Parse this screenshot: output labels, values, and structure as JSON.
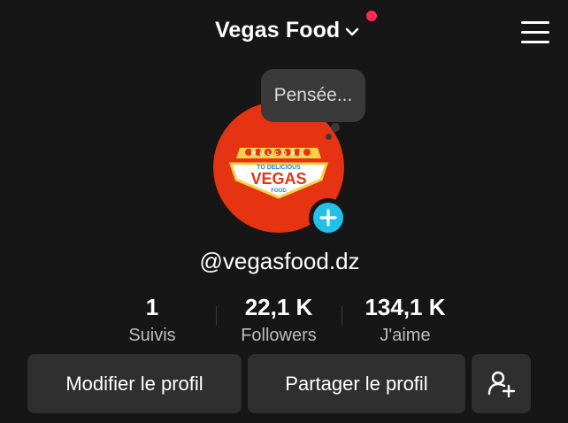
{
  "header": {
    "account_name": "Vegas Food",
    "notification_color": "#fe2c55",
    "menu_icon": "hamburger-menu-icon"
  },
  "thought_bubble": {
    "text": "Pensée..."
  },
  "avatar": {
    "logo_text_top": "WELCOME",
    "logo_text_line2": "TO DELICIOUS",
    "logo_text_main": "VEGAS",
    "logo_text_bottom": "FOOD",
    "background_color": "#e63312",
    "add_button_color": "#22c0e8"
  },
  "profile": {
    "username": "@vegasfood.dz"
  },
  "stats": [
    {
      "value": "1",
      "label": "Suivis"
    },
    {
      "value": "22,1 K",
      "label": "Followers"
    },
    {
      "value": "134,1 K",
      "label": "J'aime"
    }
  ],
  "actions": {
    "edit_profile": "Modifier le profil",
    "share_profile": "Partager le profil",
    "add_friends_icon": "add-user-icon"
  }
}
